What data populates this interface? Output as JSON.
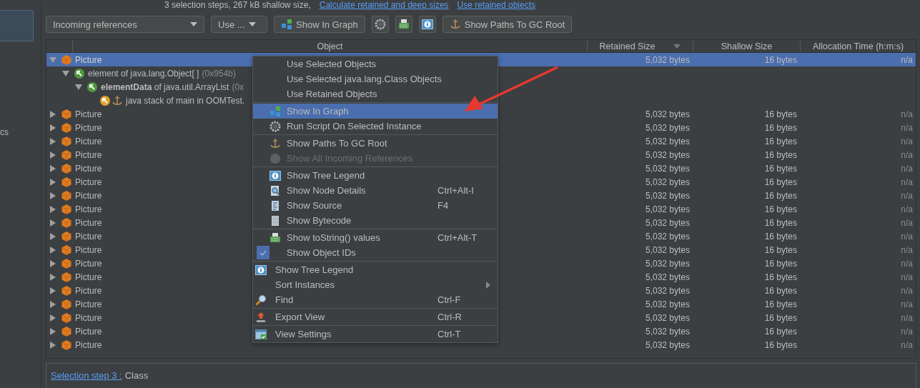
{
  "top_bar": {
    "summary": "3 selection steps, 267 kB shallow size,",
    "links": [
      "Calculate retained and deep sizes",
      "Use retained objects"
    ]
  },
  "sidebar": {
    "items": [
      {
        "selected": true
      },
      {
        "label": "cs",
        "selected": false
      }
    ]
  },
  "toolbar": {
    "view_select": "Incoming references",
    "use_button": "Use ...",
    "buttons": [
      {
        "kind": "graph",
        "label": "Show In Graph"
      },
      {
        "kind": "gear"
      },
      {
        "kind": "tostring"
      },
      {
        "kind": "info"
      },
      {
        "kind": "anchor",
        "label": "Show Paths To GC Root"
      }
    ]
  },
  "table": {
    "columns": [
      {
        "label": "Object",
        "sorted": false
      },
      {
        "label": "Retained Size",
        "sorted": true
      },
      {
        "label": "Shallow Size",
        "sorted": false
      },
      {
        "label": "Allocation Time (h:m:s)",
        "sorted": false
      }
    ],
    "rows": [
      {
        "kind": "class",
        "label": "Picture",
        "retained": "5,032 bytes",
        "shallow": "16 bytes",
        "time": "n/a",
        "selected": true,
        "expanded": true,
        "children": [
          {
            "kind": "ref",
            "label": "element of java.lang.Object[ ]",
            "note": "(0x954b)",
            "selected": false,
            "expanded": true,
            "children": [
              {
                "kind": "ref",
                "label": "**elementData** of java.util.ArrayList",
                "note": "(0x",
                "selected": false,
                "expanded": true,
                "children": [
                  {
                    "kind": "root",
                    "label": "java stack of main in OOMTest.",
                    "selected": false
                  }
                ]
              }
            ]
          }
        ]
      },
      {
        "kind": "class",
        "label": "Picture",
        "retained": "5,032 bytes",
        "shallow": "16 bytes",
        "time": "n/a",
        "selected": false,
        "expanded": false
      },
      {
        "kind": "class",
        "label": "Picture",
        "retained": "5,032 bytes",
        "shallow": "16 bytes",
        "time": "n/a",
        "selected": false,
        "expanded": false
      },
      {
        "kind": "class",
        "label": "Picture",
        "retained": "5,032 bytes",
        "shallow": "16 bytes",
        "time": "n/a",
        "selected": false,
        "expanded": false
      },
      {
        "kind": "class",
        "label": "Picture",
        "retained": "5,032 bytes",
        "shallow": "16 bytes",
        "time": "n/a",
        "selected": false,
        "expanded": false
      },
      {
        "kind": "class",
        "label": "Picture",
        "retained": "5,032 bytes",
        "shallow": "16 bytes",
        "time": "n/a",
        "selected": false,
        "expanded": false
      },
      {
        "kind": "class",
        "label": "Picture",
        "retained": "5,032 bytes",
        "shallow": "16 bytes",
        "time": "n/a",
        "selected": false,
        "expanded": false
      },
      {
        "kind": "class",
        "label": "Picture",
        "retained": "5,032 bytes",
        "shallow": "16 bytes",
        "time": "n/a",
        "selected": false,
        "expanded": false
      },
      {
        "kind": "class",
        "label": "Picture",
        "retained": "5,032 bytes",
        "shallow": "16 bytes",
        "time": "n/a",
        "selected": false,
        "expanded": false
      },
      {
        "kind": "class",
        "label": "Picture",
        "retained": "5,032 bytes",
        "shallow": "16 bytes",
        "time": "n/a",
        "selected": false,
        "expanded": false
      },
      {
        "kind": "class",
        "label": "Picture",
        "retained": "5,032 bytes",
        "shallow": "16 bytes",
        "time": "n/a",
        "selected": false,
        "expanded": false
      },
      {
        "kind": "class",
        "label": "Picture",
        "retained": "5,032 bytes",
        "shallow": "16 bytes",
        "time": "n/a",
        "selected": false,
        "expanded": false
      },
      {
        "kind": "class",
        "label": "Picture",
        "retained": "5,032 bytes",
        "shallow": "16 bytes",
        "time": "n/a",
        "selected": false,
        "expanded": false
      },
      {
        "kind": "class",
        "label": "Picture",
        "retained": "5,032 bytes",
        "shallow": "16 bytes",
        "time": "n/a",
        "selected": false,
        "expanded": false
      },
      {
        "kind": "class",
        "label": "Picture",
        "retained": "5,032 bytes",
        "shallow": "16 bytes",
        "time": "n/a",
        "selected": false,
        "expanded": false
      },
      {
        "kind": "class",
        "label": "Picture",
        "retained": "5,032 bytes",
        "shallow": "16 bytes",
        "time": "n/a",
        "selected": false,
        "expanded": false
      },
      {
        "kind": "class",
        "label": "Picture",
        "retained": "5,032 bytes",
        "shallow": "16 bytes",
        "time": "n/a",
        "selected": false,
        "expanded": false
      },
      {
        "kind": "class",
        "label": "Picture",
        "retained": "5,032 bytes",
        "shallow": "16 bytes",
        "time": "n/a",
        "selected": false,
        "expanded": false
      },
      {
        "kind": "class",
        "label": "Picture",
        "retained": "5,032 bytes",
        "shallow": "16 bytes",
        "time": "n/a",
        "selected": false,
        "expanded": false
      }
    ]
  },
  "context_menu": {
    "sections": [
      {
        "check_column": true,
        "items": [
          {
            "kind": "none",
            "label": "Use Selected Objects",
            "selected": false,
            "disabled": false
          },
          {
            "kind": "none",
            "label": "Use Selected java.lang.Class Objects",
            "selected": false,
            "disabled": false
          },
          {
            "kind": "none",
            "label": "Use Retained Objects",
            "selected": false,
            "disabled": false
          }
        ]
      },
      {
        "check_column": true,
        "items": [
          {
            "kind": "graph",
            "label": "Show In Graph",
            "selected": true,
            "disabled": false
          },
          {
            "kind": "gear",
            "label": "Run Script On Selected Instance",
            "selected": false,
            "disabled": false
          }
        ]
      },
      {
        "check_column": true,
        "items": [
          {
            "kind": "anchor",
            "label": "Show Paths To GC Root",
            "selected": false,
            "disabled": false
          },
          {
            "kind": "circle",
            "label": "Show All Incoming References",
            "selected": false,
            "disabled": true
          }
        ]
      },
      {
        "check_column": true,
        "items": [
          {
            "kind": "info",
            "label": "Show Tree Legend",
            "selected": false,
            "disabled": false
          },
          {
            "kind": "details",
            "label": "Show Node Details",
            "shortcut": "Ctrl+Alt-I",
            "selected": false,
            "disabled": false
          },
          {
            "kind": "source",
            "label": "Show Source",
            "shortcut": "F4",
            "selected": false,
            "disabled": false
          },
          {
            "kind": "bytecode",
            "label": "Show Bytecode",
            "selected": false,
            "disabled": false
          }
        ]
      },
      {
        "check_column": true,
        "items": [
          {
            "kind": "tostring",
            "label": "Show toString() values",
            "shortcut": "Ctrl+Alt-T",
            "selected": false,
            "disabled": false
          },
          {
            "kind": "checkbox",
            "label": "Show Object IDs",
            "checked": true,
            "selected": false,
            "disabled": false
          }
        ]
      },
      {
        "check_column": false,
        "items": [
          {
            "kind": "info",
            "label": "Show Tree Legend",
            "selected": false,
            "disabled": false
          },
          {
            "kind": "submenu",
            "label": "Sort Instances",
            "selected": false,
            "disabled": false
          },
          {
            "kind": "find",
            "label": "Find",
            "shortcut": "Ctrl-F",
            "selected": false,
            "disabled": false
          }
        ]
      },
      {
        "check_column": false,
        "items": [
          {
            "kind": "export",
            "label": "Export View",
            "shortcut": "Ctrl-R",
            "selected": false,
            "disabled": false
          }
        ]
      },
      {
        "check_column": false,
        "items": [
          {
            "kind": "settings",
            "label": "View Settings",
            "shortcut": "Ctrl-T",
            "selected": false,
            "disabled": false
          }
        ]
      }
    ]
  },
  "selection_panel": {
    "link": "Selection step 3 :",
    "value": "Class"
  }
}
